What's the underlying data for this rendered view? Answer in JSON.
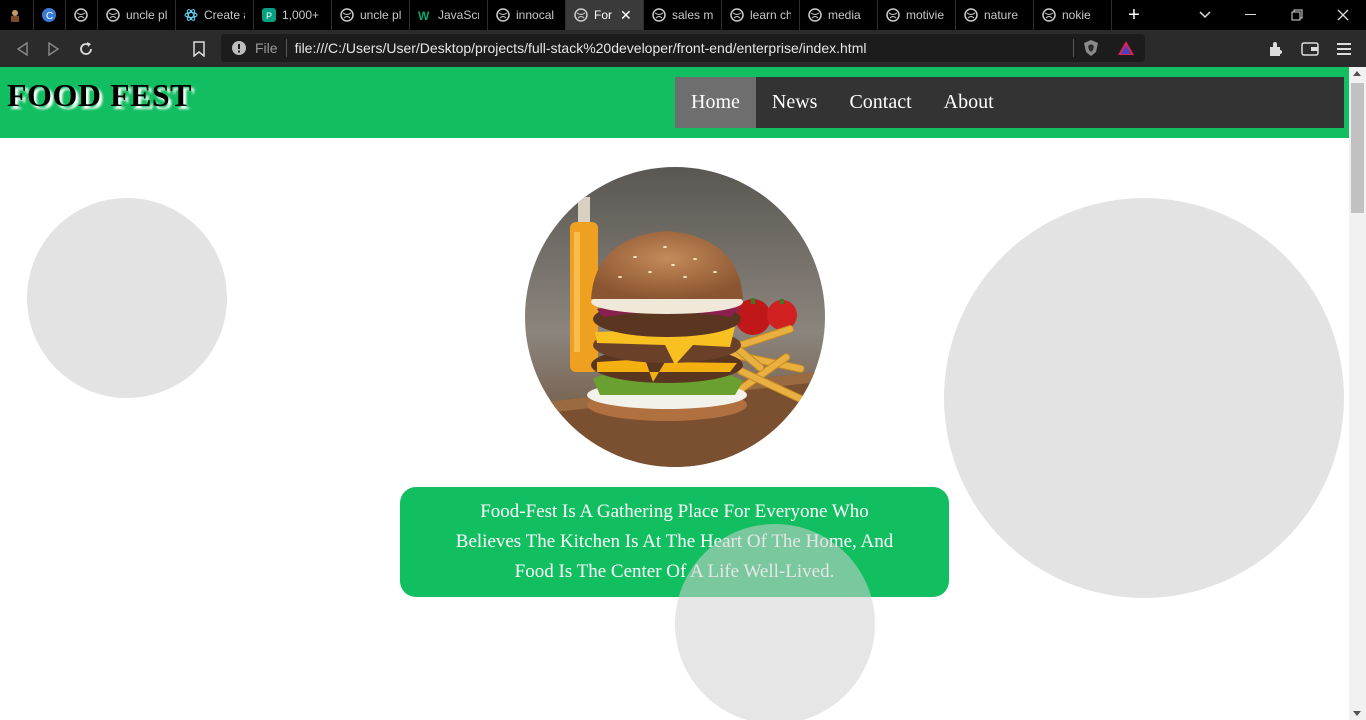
{
  "browser": {
    "tabs": [
      {
        "title": "",
        "icon": "avatar-icon"
      },
      {
        "title": "",
        "icon": "canva-icon"
      },
      {
        "title": "",
        "icon": "globe-icon"
      },
      {
        "title": "uncle pl",
        "icon": "globe-icon"
      },
      {
        "title": "Create a",
        "icon": "react-icon"
      },
      {
        "title": "1,000+",
        "icon": "pexels-icon"
      },
      {
        "title": "uncle pl",
        "icon": "globe-icon"
      },
      {
        "title": "JavaScr",
        "icon": "w3schools-icon"
      },
      {
        "title": "innocal",
        "icon": "globe-icon"
      },
      {
        "title": "For",
        "icon": "globe-icon",
        "active": true
      },
      {
        "title": "sales m",
        "icon": "globe-icon"
      },
      {
        "title": "learn ch",
        "icon": "globe-icon"
      },
      {
        "title": "media",
        "icon": "globe-icon"
      },
      {
        "title": "motivie",
        "icon": "globe-icon"
      },
      {
        "title": "nature",
        "icon": "globe-icon"
      },
      {
        "title": "nokie",
        "icon": "globe-icon"
      }
    ],
    "file_label": "File",
    "url": "file:///C:/Users/User/Desktop/projects/full-stack%20developer/front-end/enterprise/index.html"
  },
  "site": {
    "logo": "FOOD FEST",
    "nav": [
      "Home",
      "News",
      "Contact",
      "About"
    ],
    "active_nav": "Home",
    "tagline": "Food-Fest Is A Gathering Place For Everyone Who Believes The Kitchen Is At The Heart Of The Home, And Food Is The Center Of A Life Well-Lived.",
    "colors": {
      "accent": "#11bf61",
      "nav_bg": "#333333",
      "nav_active": "#6e6e6e",
      "bubble": "#e3e3e3"
    }
  }
}
